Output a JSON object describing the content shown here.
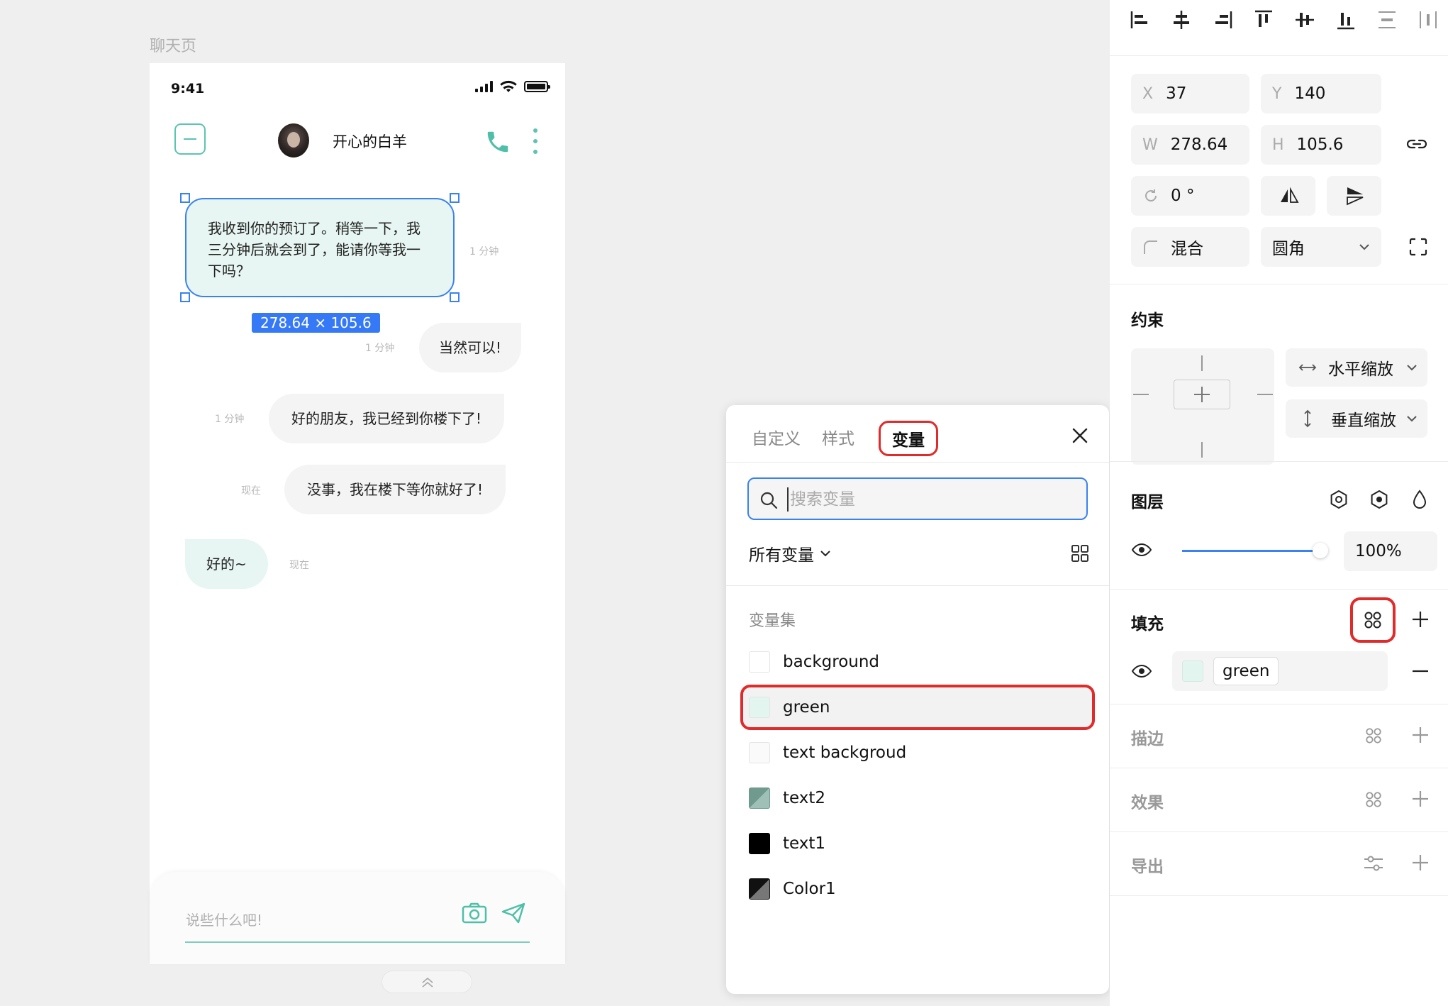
{
  "canvas": {
    "frame_label": "聊天页"
  },
  "phone": {
    "status_time": "9:41",
    "contact_name": "开心的白羊",
    "messages": [
      {
        "side": "left",
        "text": "我收到你的预订了。稍等一下，我三分钟后就会到了，能请你等我一下吗？",
        "time": "1 分钟"
      },
      {
        "side": "right",
        "text": "当然可以!",
        "time": "1 分钟"
      },
      {
        "side": "right",
        "text": "好的朋友，我已经到你楼下了!",
        "time": "1 分钟"
      },
      {
        "side": "right",
        "text": "没事，我在楼下等你就好了!",
        "time": "现在"
      },
      {
        "side": "left",
        "text": "好的~",
        "time": "现在"
      }
    ],
    "selection_size": "278.64 × 105.6",
    "input_placeholder": "说些什么吧!"
  },
  "variables_popup": {
    "tabs": [
      "自定义",
      "样式",
      "变量"
    ],
    "active_tab": "变量",
    "search_placeholder": "搜索变量",
    "filter_label": "所有变量",
    "set_label": "变量集",
    "variables": [
      {
        "name": "background",
        "color": "#ffffff",
        "selected": false
      },
      {
        "name": "green",
        "color": "#e3f5ef",
        "selected": true
      },
      {
        "name": "text backgroud",
        "color": "#fafafa",
        "selected": false
      },
      {
        "name": "text2",
        "color": "#6f9a8d",
        "selected": false
      },
      {
        "name": "text1",
        "color": "#000000",
        "selected": false
      },
      {
        "name": "Color1",
        "color": "#1a1a1a",
        "selected": false
      }
    ]
  },
  "inspector": {
    "x_label": "X",
    "x_value": "37",
    "y_label": "Y",
    "y_value": "140",
    "w_label": "W",
    "w_value": "278.64",
    "h_label": "H",
    "h_value": "105.6",
    "rotation_value": "0 °",
    "blend_label": "混合",
    "corner_label": "圆角",
    "constraints_title": "约束",
    "horizontal_constraint": "水平缩放",
    "vertical_constraint": "垂直缩放",
    "layer_title": "图层",
    "opacity": "100%",
    "opacity_fraction": 1.0,
    "fill_title": "填充",
    "fill_variable": "green",
    "stroke_title": "描边",
    "effects_title": "效果",
    "export_title": "导出"
  },
  "colors": {
    "accent": "#5cc4b0",
    "selection": "#3a82ef",
    "highlight": "#e02b2b",
    "bubble_green": "#e7f6f2"
  }
}
